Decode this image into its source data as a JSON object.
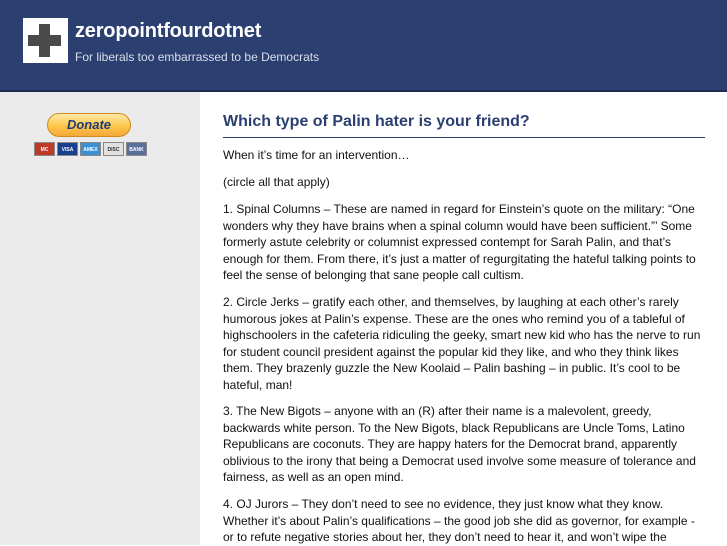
{
  "header": {
    "site_title": "zeropointfourdotnet",
    "tagline": "For liberals too embarrassed to be Democrats",
    "logo_icon": "plus-squares-logo-icon"
  },
  "sidebar": {
    "donate_label": "Donate",
    "cards": [
      {
        "name": "mastercard-icon",
        "label": "MC",
        "color": "#c0392b"
      },
      {
        "name": "visa-icon",
        "label": "VISA",
        "color": "#1a3f8f"
      },
      {
        "name": "amex-icon",
        "label": "AMEX",
        "color": "#3c8fd1"
      },
      {
        "name": "discover-icon",
        "label": "DISC",
        "color": "#e0e0e0"
      },
      {
        "name": "bank-icon",
        "label": "BANK",
        "color": "#5a6f99"
      }
    ]
  },
  "post": {
    "title": "Which type of Palin hater is your friend?",
    "paragraphs": [
      "When it’s time for an intervention…",
      "(circle all that apply)",
      "1. Spinal Columns – These are named in regard for Einstein’s quote on the military: “One wonders why they have brains when a spinal column would have been sufficient.”’ Some formerly astute celebrity or columnist expressed contempt for Sarah Palin, and that’s enough for them. From there, it’s just a matter of regurgitating the hateful talking points to feel the sense of belonging that sane people call cultism.",
      "2. Circle Jerks – gratify each other, and themselves, by laughing at each other’s rarely humorous jokes at Palin’s expense. These are the ones who remind you of a tableful of highschoolers in the cafeteria ridiculing the geeky, smart new kid who has the nerve to run for student council president against the popular kid they like, and who they think likes them. They brazenly guzzle the New Koolaid – Palin bashing – in public. It’s cool to be hateful, man!",
      "3. The New Bigots – anyone with an (R) after their name is a malevolent, greedy, backwards white person. To the New Bigots, black Republicans are Uncle Toms, Latino Republicans are coconuts. They are happy haters for the Democrat brand, apparently oblivious to the irony that being a Democrat used involve some measure of tolerance and fairness, as well as an open mind.",
      "4. OJ Jurors – They don’t need to see no evidence, they just know what they know. Whether it’s about Palin’s qualifications – the good job she did as governor, for example - or to refute negative stories about her, they don’t need to hear it, and won’t wipe the"
    ]
  }
}
